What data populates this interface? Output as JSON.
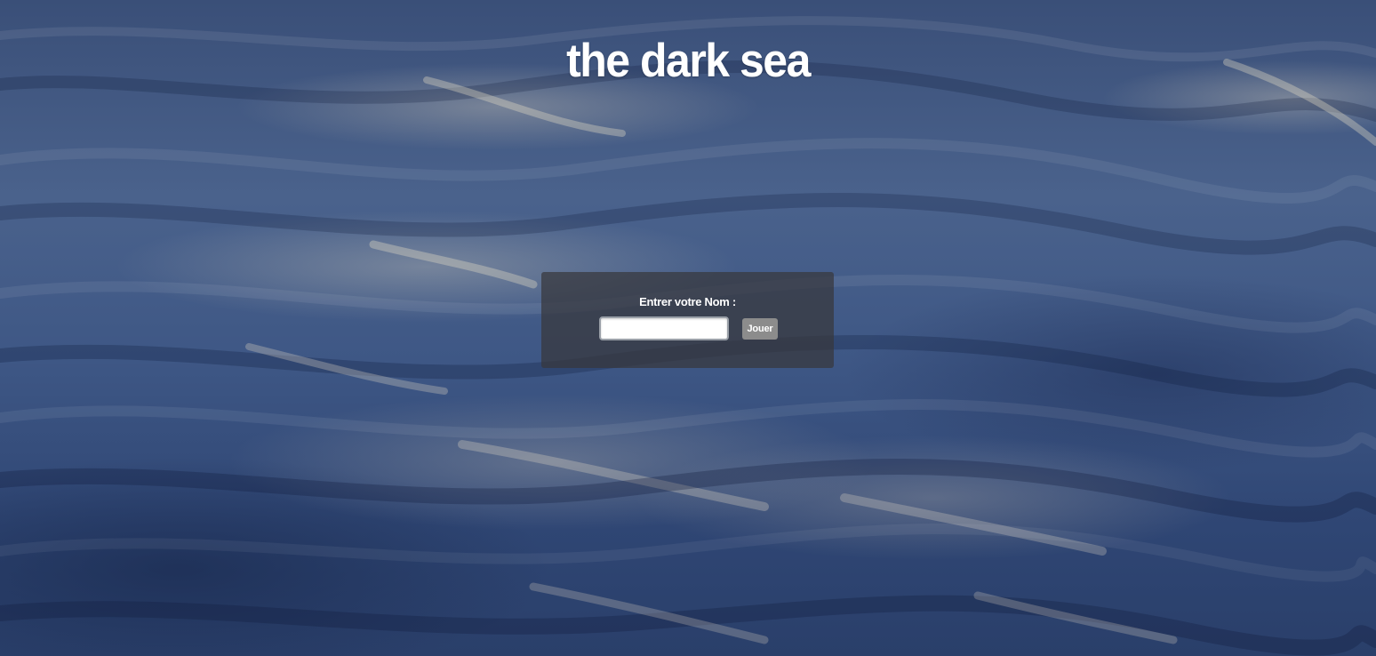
{
  "header": {
    "title": "the dark sea"
  },
  "login": {
    "label": "Entrer votre Nom :",
    "name_value": "",
    "play_label": "Jouer"
  },
  "colors": {
    "sea_dark": "#2a3f6a",
    "sea_mid": "#4a628c",
    "panel": "#37373c",
    "button": "#8c8c8c",
    "title_text": "#ffffff"
  }
}
